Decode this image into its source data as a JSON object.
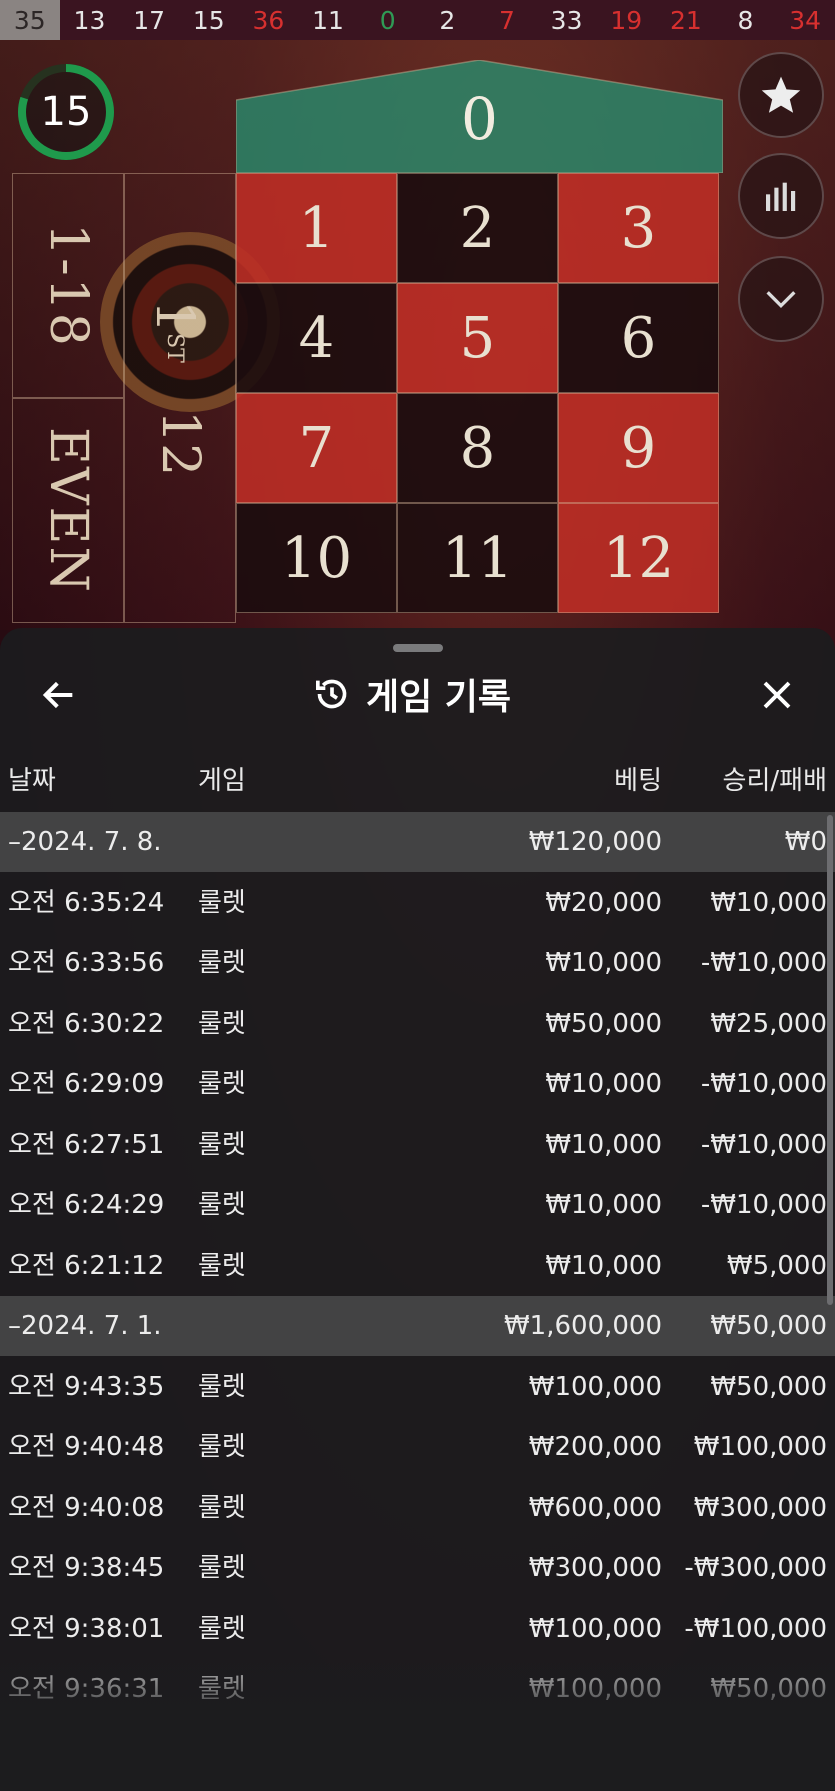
{
  "history_numbers": [
    {
      "value": "35",
      "color": "first"
    },
    {
      "value": "13",
      "color": "black"
    },
    {
      "value": "17",
      "color": "black"
    },
    {
      "value": "15",
      "color": "black"
    },
    {
      "value": "36",
      "color": "red"
    },
    {
      "value": "11",
      "color": "black"
    },
    {
      "value": "0",
      "color": "green"
    },
    {
      "value": "2",
      "color": "black"
    },
    {
      "value": "7",
      "color": "red"
    },
    {
      "value": "33",
      "color": "black"
    },
    {
      "value": "19",
      "color": "red"
    },
    {
      "value": "21",
      "color": "red"
    },
    {
      "value": "8",
      "color": "black"
    },
    {
      "value": "34",
      "color": "red"
    }
  ],
  "timer": {
    "value": "15",
    "progress_fraction": 0.8,
    "color": "#1f9a4c"
  },
  "table": {
    "zero_label": "0",
    "side_labels": {
      "low": "1-18",
      "even": "EVEN",
      "dozen": "1",
      "dozen_suffix": "ST",
      "dozen_number": "12"
    },
    "cells": [
      {
        "n": "1",
        "color": "red"
      },
      {
        "n": "2",
        "color": "black"
      },
      {
        "n": "3",
        "color": "red"
      },
      {
        "n": "4",
        "color": "black"
      },
      {
        "n": "5",
        "color": "red"
      },
      {
        "n": "6",
        "color": "black"
      },
      {
        "n": "7",
        "color": "red"
      },
      {
        "n": "8",
        "color": "black"
      },
      {
        "n": "9",
        "color": "red"
      },
      {
        "n": "10",
        "color": "black"
      },
      {
        "n": "11",
        "color": "black"
      },
      {
        "n": "12",
        "color": "red"
      }
    ]
  },
  "right_buttons": [
    {
      "icon": "star-icon"
    },
    {
      "icon": "stats-bars-icon"
    },
    {
      "icon": "chevron-down-icon"
    }
  ],
  "panel": {
    "title": "게임 기록",
    "title_icon": "history-icon",
    "columns": {
      "date": "날짜",
      "game": "게임",
      "bet": "베팅",
      "result": "승리/패배"
    },
    "groups": [
      {
        "date": "–2024. 7. 8.",
        "bet": "₩120,000",
        "result": "₩0",
        "rows": [
          {
            "time": "오전 6:35:24",
            "game": "룰렛",
            "bet": "₩20,000",
            "result": "₩10,000"
          },
          {
            "time": "오전 6:33:56",
            "game": "룰렛",
            "bet": "₩10,000",
            "result": "-₩10,000"
          },
          {
            "time": "오전 6:30:22",
            "game": "룰렛",
            "bet": "₩50,000",
            "result": "₩25,000"
          },
          {
            "time": "오전 6:29:09",
            "game": "룰렛",
            "bet": "₩10,000",
            "result": "-₩10,000"
          },
          {
            "time": "오전 6:27:51",
            "game": "룰렛",
            "bet": "₩10,000",
            "result": "-₩10,000"
          },
          {
            "time": "오전 6:24:29",
            "game": "룰렛",
            "bet": "₩10,000",
            "result": "-₩10,000"
          },
          {
            "time": "오전 6:21:12",
            "game": "룰렛",
            "bet": "₩10,000",
            "result": "₩5,000"
          }
        ]
      },
      {
        "date": "–2024. 7. 1.",
        "bet": "₩1,600,000",
        "result": "₩50,000",
        "rows": [
          {
            "time": "오전 9:43:35",
            "game": "룰렛",
            "bet": "₩100,000",
            "result": "₩50,000"
          },
          {
            "time": "오전 9:40:48",
            "game": "룰렛",
            "bet": "₩200,000",
            "result": "₩100,000"
          },
          {
            "time": "오전 9:40:08",
            "game": "룰렛",
            "bet": "₩600,000",
            "result": "₩300,000"
          },
          {
            "time": "오전 9:38:45",
            "game": "룰렛",
            "bet": "₩300,000",
            "result": "-₩300,000"
          },
          {
            "time": "오전 9:38:01",
            "game": "룰렛",
            "bet": "₩100,000",
            "result": "-₩100,000"
          },
          {
            "time": "오전 9:36:31",
            "game": "룰렛",
            "bet": "₩100,000",
            "result": "₩50,000"
          }
        ]
      }
    ]
  }
}
